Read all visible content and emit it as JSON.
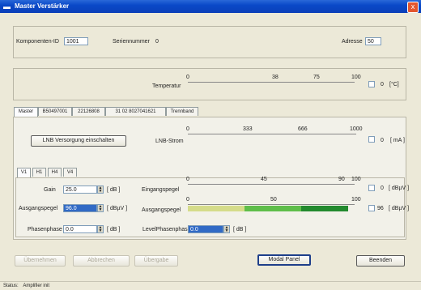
{
  "window": {
    "title": "Master Verstärker",
    "close_label": "x"
  },
  "header": {
    "component_id_label": "Komponenten-ID",
    "component_id_value": "1001",
    "serial_label": "Seriennummer",
    "serial_value": "0",
    "address_label": "Adresse",
    "address_value": "50"
  },
  "temperature": {
    "label": "Temperatur",
    "ticks": [
      "0",
      "38",
      "75",
      "100"
    ],
    "value": "0",
    "unit": "[°C]"
  },
  "tabs": [
    "Master",
    "B50497001",
    "22126808",
    "31 02 8027041621",
    "Trennband"
  ],
  "lnb": {
    "button_label": "LNB Versorgung einschalten",
    "label": "LNB-Strom",
    "ticks": [
      "0",
      "333",
      "666",
      "1000"
    ],
    "value": "0",
    "unit": "[ mA ]"
  },
  "subtabs": [
    "V1",
    "H1",
    "H4",
    "V4"
  ],
  "gain": {
    "label": "Gain",
    "value": "25.0",
    "unit": "[ dB ]"
  },
  "output_level": {
    "label": "Ausgangspegel",
    "value": "96.0",
    "unit": "[ dBµV ]"
  },
  "phase_shift": {
    "label": "Phasenphase",
    "value": "0.0",
    "unit": "[ dB ]"
  },
  "level_phase": {
    "label": "LevelPhasenphase",
    "value": "0.0",
    "unit": "[ dB ]"
  },
  "input_meter": {
    "label": "Eingangspegel",
    "ticks": [
      "0",
      "45",
      "90",
      "100"
    ],
    "value": "0",
    "unit": "[ dBµV ]"
  },
  "output_meter": {
    "label": "Ausgangspegel",
    "ticks": [
      "0",
      "50",
      "100"
    ],
    "value": "96",
    "unit": "[ dBµV ]",
    "fill_fraction": 0.96
  },
  "buttons": {
    "b1": "Übernehmen",
    "b2": "Abbrechen",
    "b3": "Übergabe",
    "modal_panel": "Modal Panel",
    "close": "Beenden"
  },
  "status": {
    "label": "Status:",
    "value": "Amplifier init"
  },
  "colors": {
    "bar_yellow": "#d5dc8a",
    "bar_light_green": "#5fbe4a",
    "bar_dark_green": "#238a2e"
  }
}
